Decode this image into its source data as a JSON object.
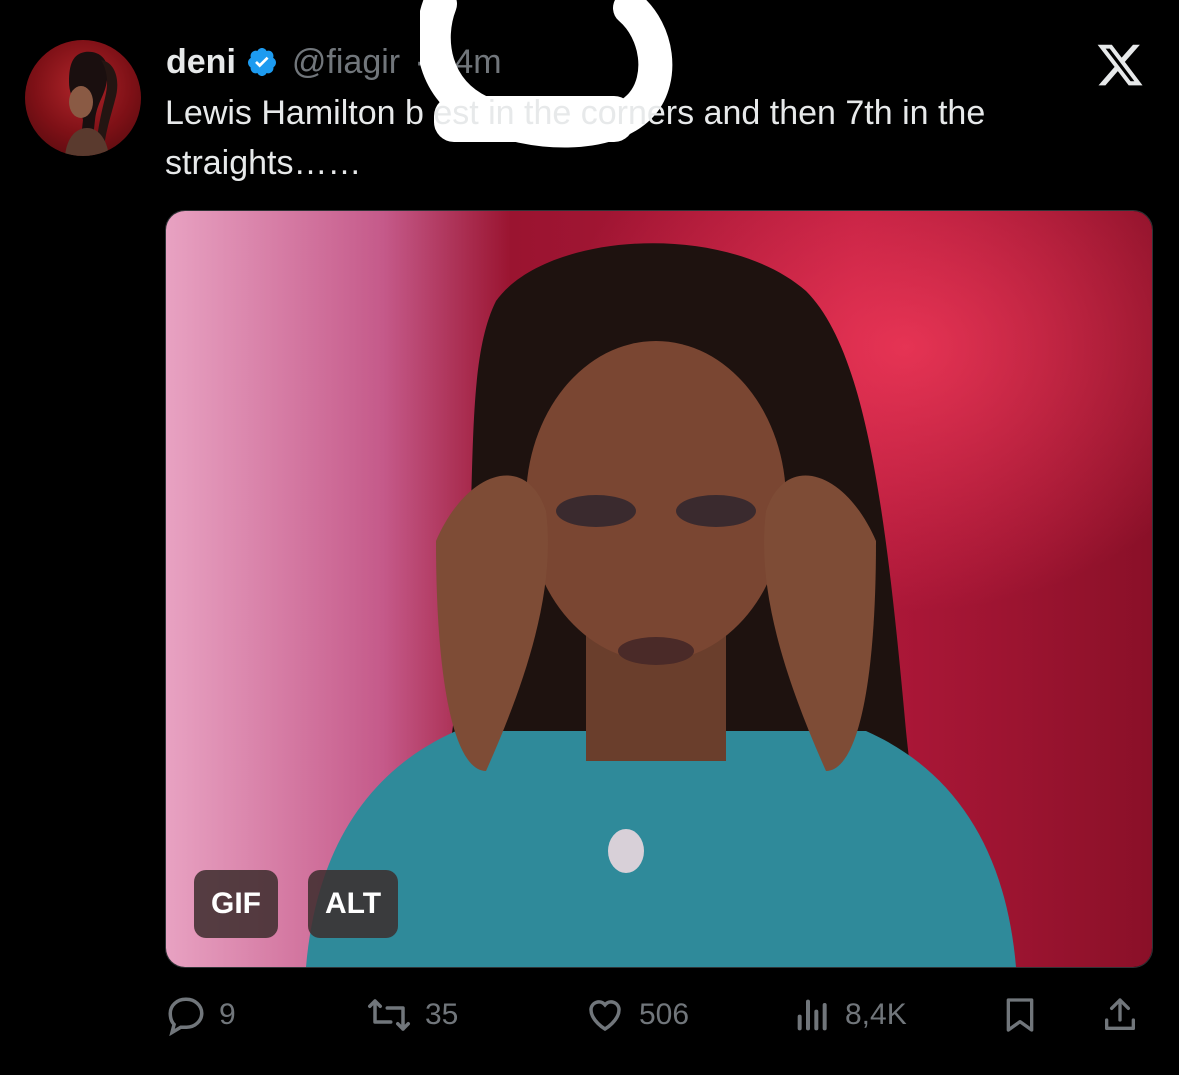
{
  "post": {
    "display_name": "deni",
    "handle": "@fiagir",
    "separator": "·",
    "time": "44m",
    "text": "Lewis Hamilton b          est in the corners and then 7th in the straights……"
  },
  "media": {
    "badges": {
      "gif": "GIF",
      "alt": "ALT"
    }
  },
  "actions": {
    "replies": "9",
    "reposts": "35",
    "likes": "506",
    "views": "8,4K"
  },
  "icons": {
    "verified": "verified-badge-icon",
    "platform": "x-logo-icon",
    "reply": "reply-icon",
    "repost": "repost-icon",
    "like": "heart-icon",
    "views": "views-icon",
    "bookmark": "bookmark-icon",
    "share": "share-icon"
  },
  "colors": {
    "background": "#000000",
    "text": "#e7e9ea",
    "muted": "#71767b",
    "verified": "#1d9bf0"
  }
}
